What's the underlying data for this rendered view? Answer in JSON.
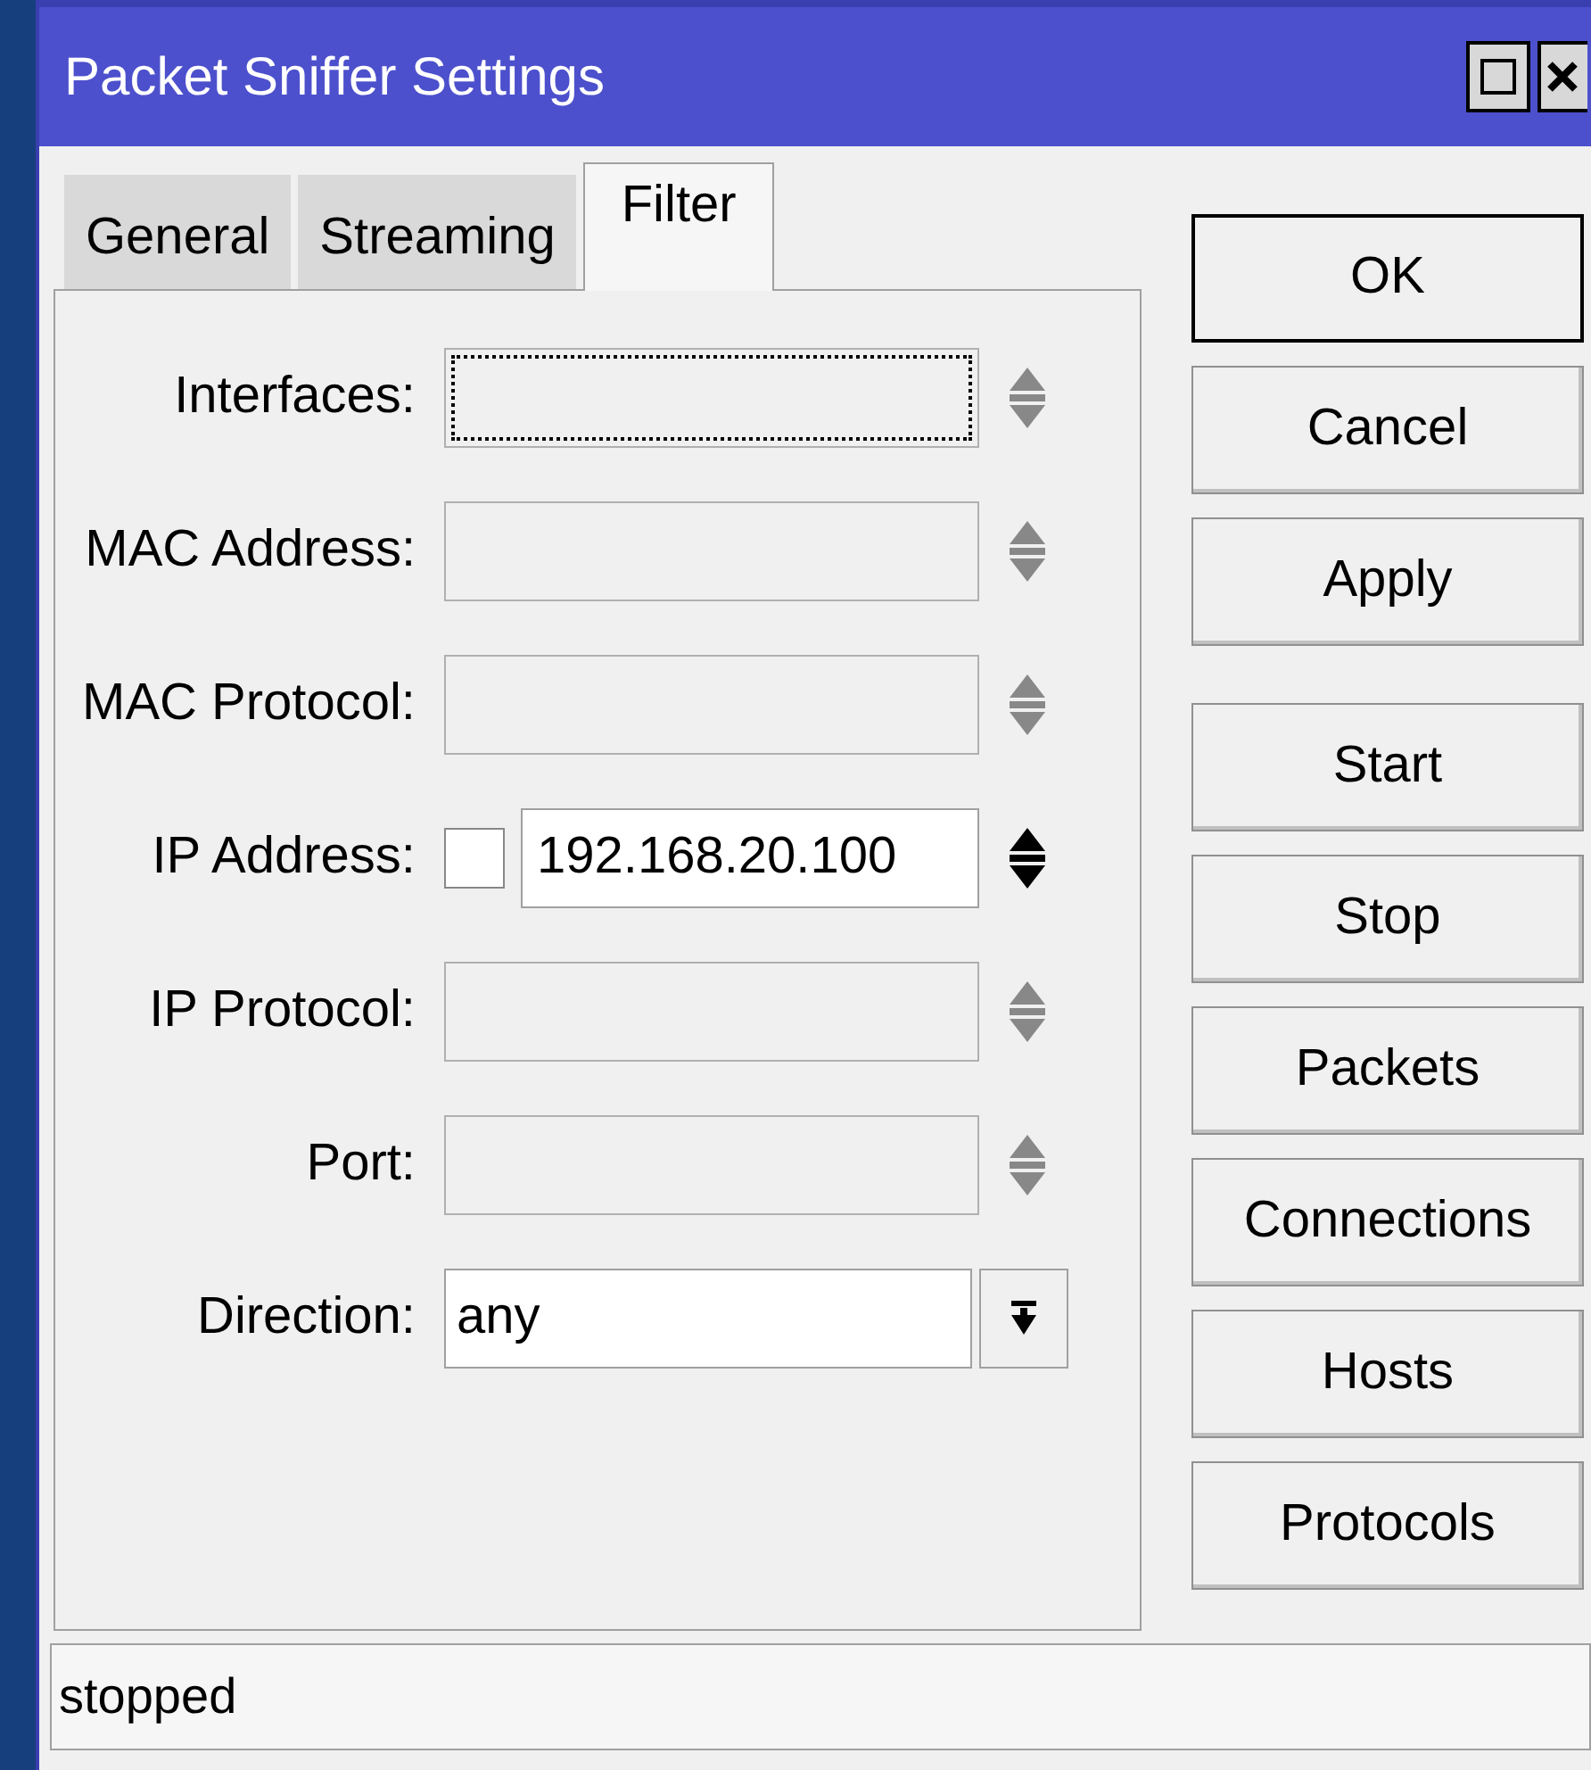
{
  "window": {
    "title": "Packet Sniffer Settings"
  },
  "tabs": [
    {
      "label": "General",
      "selected": false
    },
    {
      "label": "Streaming",
      "selected": false
    },
    {
      "label": "Filter",
      "selected": true
    }
  ],
  "fields": [
    {
      "kind": "text",
      "label": "Interfaces:",
      "focused": true,
      "active": false
    },
    {
      "kind": "text",
      "label": "MAC Address:",
      "focused": false,
      "active": false
    },
    {
      "kind": "text",
      "label": "MAC Protocol:",
      "focused": false,
      "active": false
    },
    {
      "kind": "check-text",
      "label": "IP Address:",
      "checked": false,
      "value": "192.168.20.100",
      "focused": false,
      "active": true
    },
    {
      "kind": "text",
      "label": "IP Protocol:",
      "focused": false,
      "active": false
    },
    {
      "kind": "text",
      "label": "Port:",
      "focused": false,
      "active": false
    },
    {
      "kind": "dropdown",
      "label": "Direction:",
      "value": "any"
    }
  ],
  "dialog_buttons": [
    {
      "label": "OK",
      "default": true
    },
    {
      "label": "Cancel",
      "default": false
    },
    {
      "label": "Apply",
      "default": false
    }
  ],
  "action_buttons": [
    {
      "label": "Start"
    },
    {
      "label": "Stop"
    },
    {
      "label": "Packets"
    },
    {
      "label": "Connections"
    },
    {
      "label": "Hosts"
    },
    {
      "label": "Protocols"
    }
  ],
  "status_bar": {
    "text": "stopped"
  }
}
